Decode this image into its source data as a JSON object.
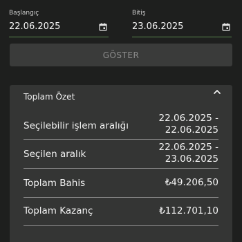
{
  "filters": {
    "start": {
      "label": "Başlangıç",
      "value": "22.06.2025"
    },
    "end": {
      "label": "Bitiş",
      "value": "23.06.2025"
    }
  },
  "show_button": {
    "label": "GÖSTER"
  },
  "summary": {
    "title": "Toplam Özet",
    "rows": [
      {
        "label": "Seçilebilir işlem aralığı",
        "value_line1": "22.06.2025 -",
        "value_line2": "22.06.2025"
      },
      {
        "label": "Seçilen aralık",
        "value_line1": "22.06.2025 -",
        "value_line2": "23.06.2025"
      },
      {
        "label": "Toplam Bahis",
        "value": "₺49.206,50"
      },
      {
        "label": "Toplam Kazanç",
        "value": "₺112.701,10"
      }
    ]
  },
  "icons": {
    "calendar": "calendar-icon",
    "collapse": "chevron-up-icon"
  },
  "colors": {
    "background": "#1e1f1e",
    "card": "#343534",
    "input_underline": "#5b8a4e",
    "button": "#3a3b3a"
  }
}
